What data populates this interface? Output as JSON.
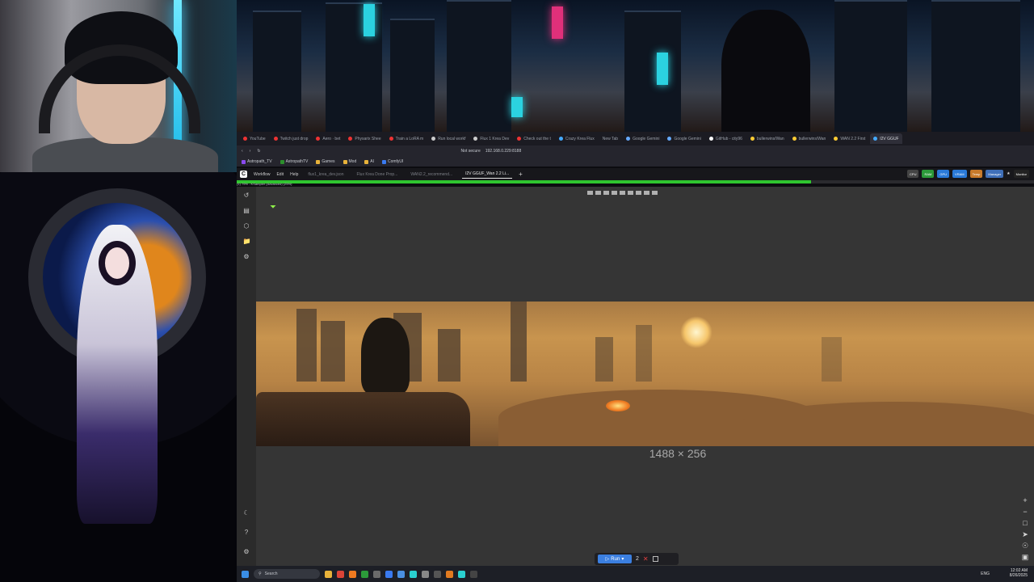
{
  "browser": {
    "tabs": [
      "YouTube",
      "Twitch just drop",
      "Aero · bet",
      "Physarix Shee",
      "Train a LoRA m",
      "Run local workf",
      "Flux 1 Krea Dev",
      "Check out the t",
      "Crazy Krea Flux",
      "New Tab",
      "Google Gemini",
      "Google Gemini",
      "GitHub - city96",
      "bullerwins/Wan",
      "bullerwins/Wan",
      "WAN 2.2 First",
      "I2V GGUF"
    ],
    "security": "Not secure",
    "url": "192.168.0.229:8188",
    "bookmarks": [
      "Astropath_TV",
      "AstropathTV",
      "Games",
      "Mod",
      "AI",
      "ComfyUI"
    ]
  },
  "comfy": {
    "menu": [
      "Workflow",
      "Edit",
      "Help"
    ],
    "workflow_tabs": [
      "flux1_krea_dev.json",
      "Flux Krea Done Prop...",
      "WAN2.2_recommend...",
      "I2V GGUF_Wan 2.2 Li..."
    ],
    "queue_status": "(1) 79% - KSampler (Advanced) (25%)",
    "resources": [
      "CPU",
      "RAM",
      "GPU",
      "VRAM",
      "Temp"
    ],
    "manager": "Manager",
    "monitor": "Monitor",
    "image_dims": "1488 × 256",
    "run_label": "Run",
    "batch_count": "2"
  },
  "taskbar": {
    "search": "Search",
    "time": "12:02 AM",
    "date": "8/26/2025",
    "lang": "ENG"
  },
  "colors": {
    "progress": "#2fc52f",
    "run": "#3b7fe0",
    "accent": "#3f8fe0"
  }
}
